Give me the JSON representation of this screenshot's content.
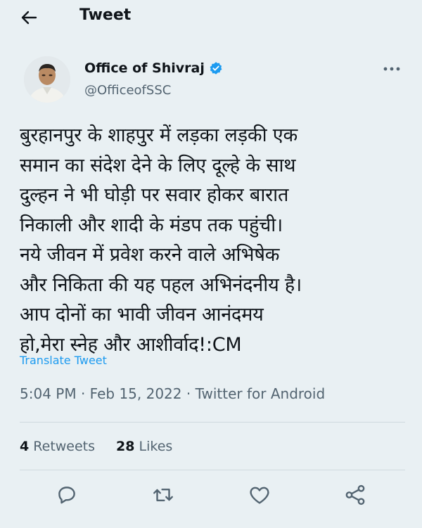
{
  "header": {
    "title": "Tweet",
    "back_icon": "back-arrow-icon"
  },
  "author": {
    "name": "Office of Shivraj",
    "handle": "@OfficeofSSC",
    "verified": true,
    "verified_color": "#1d9bf0"
  },
  "tweet": {
    "lines": [
      "बुरहानपुर के शाहपुर में लड़का लड़की एक",
      "समान का संदेश देने के लिए दूल्हे के साथ",
      "दुल्हन ने भी घोड़ी पर सवार होकर बारात",
      "निकाली और शादी के मंडप तक पहुंची।",
      "नये जीवन में प्रवेश करने वाले अभिषेक",
      "और निकिता की यह पहल अभिनंदनीय है।",
      "आप दोनों का भावी जीवन आनंदमय",
      "हो,मेरा स्नेह और आशीर्वाद!:CM"
    ],
    "translate_label": "Translate Tweet"
  },
  "meta": {
    "time": "5:04 PM",
    "date": "Feb 15, 2022",
    "source": "Twitter for Android",
    "separator": " · "
  },
  "stats": {
    "retweets_count": "4",
    "retweets_label": "Retweets",
    "likes_count": "28",
    "likes_label": "Likes"
  },
  "actions": [
    "reply-icon",
    "retweet-icon",
    "like-icon",
    "share-icon"
  ],
  "colors": {
    "accent": "#1d9bf0",
    "background": "#e9f0f3",
    "secondary_text": "#536471"
  }
}
